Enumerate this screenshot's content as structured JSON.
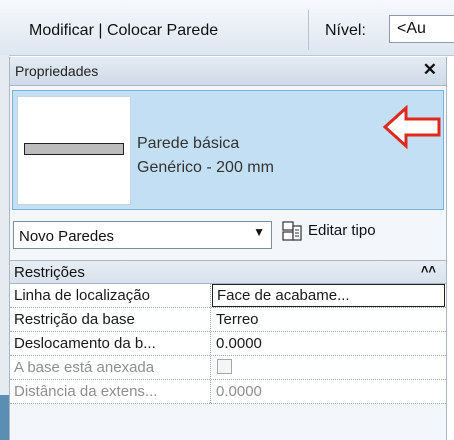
{
  "ribbon": {
    "context_title": "Modificar | Colocar Parede",
    "level_label": "Nível:",
    "level_value": "<Au"
  },
  "properties": {
    "title": "Propriedades",
    "type_selector": {
      "family": "Parede básica",
      "type_name": "Genérico - 200 mm"
    },
    "instance_filter": "Novo Paredes",
    "edit_type_label": "Editar tipo",
    "sections": [
      {
        "name": "Restrições",
        "rows": [
          {
            "name": "Linha de localização",
            "value": "Face de acabame..."
          },
          {
            "name": "Restrição da base",
            "value": "Terreo"
          },
          {
            "name": "Deslocamento da b...",
            "value": "0.0000"
          },
          {
            "name": "A base está anexada",
            "value": ""
          },
          {
            "name": "Distância da extens...",
            "value": "0.0000"
          }
        ]
      }
    ]
  },
  "colors": {
    "type_selector_bg": "#c3dff4",
    "annotation_arrow": "#e0281e"
  },
  "icons": [
    "close-icon",
    "chevron-down-icon",
    "edit-type-icon",
    "collapse-icon",
    "arrow-left-icon"
  ]
}
